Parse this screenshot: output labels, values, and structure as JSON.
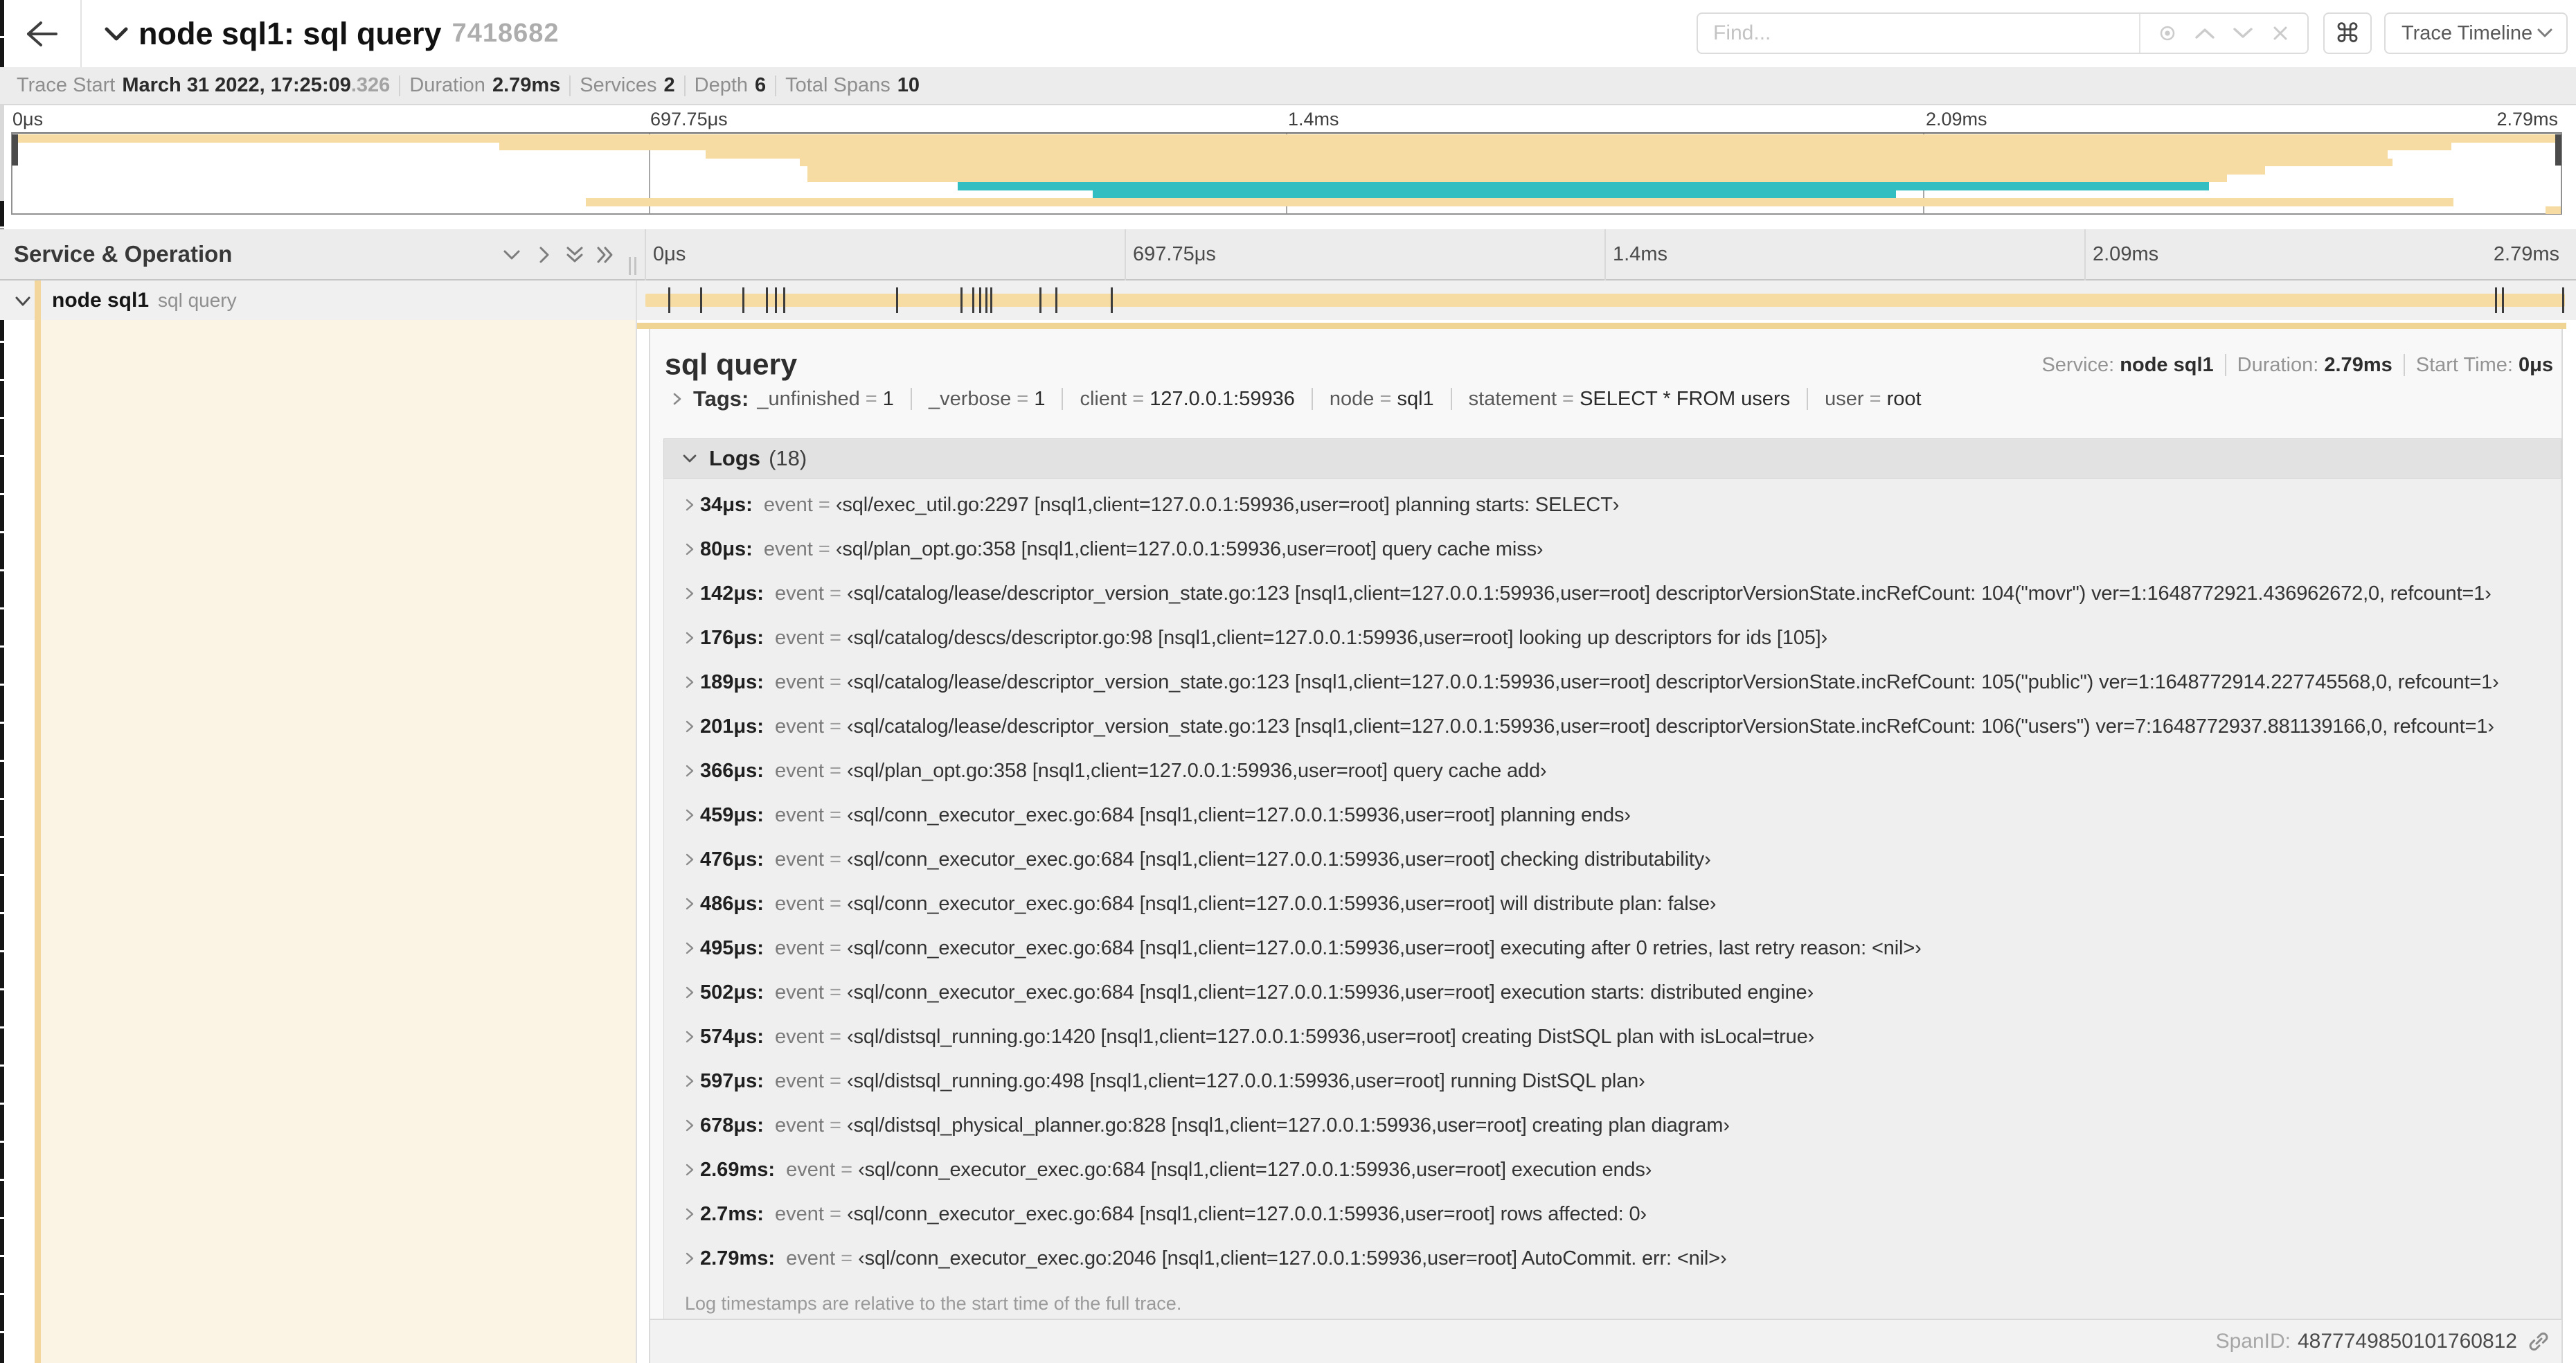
{
  "header": {
    "title": "node sql1: sql query",
    "trace_id": "7418682",
    "find_placeholder": "Find...",
    "view_dropdown_label": "Trace Timeline",
    "kbd_shortcut": "⌘"
  },
  "trace_stats": [
    {
      "label": "Trace Start",
      "value": "March 31 2022, 17:25:09",
      "suffix": ".326"
    },
    {
      "label": "Duration",
      "value": "2.79ms"
    },
    {
      "label": "Services",
      "value": "2"
    },
    {
      "label": "Depth",
      "value": "6"
    },
    {
      "label": "Total Spans",
      "value": "10"
    }
  ],
  "timeline": {
    "column_header": "Service & Operation",
    "ticks": [
      {
        "label": "0μs",
        "pct": 0
      },
      {
        "label": "697.75μs",
        "pct": 25
      },
      {
        "label": "1.4ms",
        "pct": 50
      },
      {
        "label": "2.09ms",
        "pct": 75
      },
      {
        "label": "2.79ms",
        "pct": 100,
        "align": "right"
      }
    ]
  },
  "chart_data": {
    "type": "gantt-minimap",
    "title": "trace span overview",
    "xlabel_ticks": [
      "0μs",
      "697.75μs",
      "1.4ms",
      "2.09ms",
      "2.79ms"
    ],
    "duration": "2.79ms",
    "spans": [
      {
        "start_pct": 0.0,
        "end_pct": 100.0,
        "color": "tan"
      },
      {
        "start_pct": 19.1,
        "end_pct": 95.7,
        "color": "tan"
      },
      {
        "start_pct": 27.2,
        "end_pct": 93.2,
        "color": "tan"
      },
      {
        "start_pct": 30.9,
        "end_pct": 93.4,
        "color": "tan"
      },
      {
        "start_pct": 31.2,
        "end_pct": 88.4,
        "color": "tan"
      },
      {
        "start_pct": 31.2,
        "end_pct": 86.9,
        "color": "tan"
      },
      {
        "start_pct": 37.1,
        "end_pct": 86.2,
        "color": "teal"
      },
      {
        "start_pct": 42.4,
        "end_pct": 73.9,
        "color": "teal"
      },
      {
        "start_pct": 22.5,
        "end_pct": 95.8,
        "color": "tan"
      },
      {
        "start_pct": 99.4,
        "end_pct": 100.0,
        "color": "tan"
      }
    ]
  },
  "span_row": {
    "service": "node sql1",
    "operation": "sql query",
    "bar_start_pct": 0,
    "bar_end_pct": 100
  },
  "detail": {
    "title": "sql query",
    "summary": [
      {
        "label": "Service: ",
        "value": "node sql1"
      },
      {
        "label": "Duration: ",
        "value": "2.79ms"
      },
      {
        "label": "Start Time: ",
        "value": "0μs"
      }
    ],
    "tags_label": "Tags:",
    "tags": [
      {
        "key": "_unfinished",
        "value": "1"
      },
      {
        "key": "_verbose",
        "value": "1"
      },
      {
        "key": "client",
        "value": "127.0.0.1:59936"
      },
      {
        "key": "node",
        "value": "sql1"
      },
      {
        "key": "statement",
        "value": "SELECT * FROM users"
      },
      {
        "key": "user",
        "value": "root"
      }
    ],
    "logs_label": "Logs",
    "logs_count": "(18)",
    "logs_key": "event",
    "logs": [
      {
        "time": "34μs:",
        "pct": 1.22,
        "value": "‹sql/exec_util.go:2297 [nsql1,client=127.0.0.1:59936,user=root] planning starts: SELECT›"
      },
      {
        "time": "80μs:",
        "pct": 2.87,
        "value": "‹sql/plan_opt.go:358 [nsql1,client=127.0.0.1:59936,user=root] query cache miss›"
      },
      {
        "time": "142μs:",
        "pct": 5.09,
        "value": "‹sql/catalog/lease/descriptor_version_state.go:123 [nsql1,client=127.0.0.1:59936,user=root] descriptorVersionState.incRefCount: 104(\"movr\") ver=1:1648772921.436962672,0, refcount=1›"
      },
      {
        "time": "176μs:",
        "pct": 6.31,
        "value": "‹sql/catalog/descs/descriptor.go:98 [nsql1,client=127.0.0.1:59936,user=root] looking up descriptors for ids [105]›"
      },
      {
        "time": "189μs:",
        "pct": 6.77,
        "value": "‹sql/catalog/lease/descriptor_version_state.go:123 [nsql1,client=127.0.0.1:59936,user=root] descriptorVersionState.incRefCount: 105(\"public\") ver=1:1648772914.227745568,0, refcount=1›"
      },
      {
        "time": "201μs:",
        "pct": 7.2,
        "value": "‹sql/catalog/lease/descriptor_version_state.go:123 [nsql1,client=127.0.0.1:59936,user=root] descriptorVersionState.incRefCount: 106(\"users\") ver=7:1648772937.881139166,0, refcount=1›"
      },
      {
        "time": "366μs:",
        "pct": 13.11,
        "value": "‹sql/plan_opt.go:358 [nsql1,client=127.0.0.1:59936,user=root] query cache add›"
      },
      {
        "time": "459μs:",
        "pct": 16.45,
        "value": "‹sql/conn_executor_exec.go:684 [nsql1,client=127.0.0.1:59936,user=root] planning ends›"
      },
      {
        "time": "476μs:",
        "pct": 17.06,
        "value": "‹sql/conn_executor_exec.go:684 [nsql1,client=127.0.0.1:59936,user=root] checking distributability›"
      },
      {
        "time": "486μs:",
        "pct": 17.41,
        "value": "‹sql/conn_executor_exec.go:684 [nsql1,client=127.0.0.1:59936,user=root] will distribute plan: false›"
      },
      {
        "time": "495μs:",
        "pct": 17.74,
        "value": "‹sql/conn_executor_exec.go:684 [nsql1,client=127.0.0.1:59936,user=root] executing after 0 retries, last retry reason: <nil>›"
      },
      {
        "time": "502μs:",
        "pct": 17.99,
        "value": "‹sql/conn_executor_exec.go:684 [nsql1,client=127.0.0.1:59936,user=root] execution starts: distributed engine›"
      },
      {
        "time": "574μs:",
        "pct": 20.57,
        "value": "‹sql/distsql_running.go:1420 [nsql1,client=127.0.0.1:59936,user=root] creating DistSQL plan with isLocal=true›"
      },
      {
        "time": "597μs:",
        "pct": 21.39,
        "value": "‹sql/distsql_running.go:498 [nsql1,client=127.0.0.1:59936,user=root] running DistSQL plan›"
      },
      {
        "time": "678μs:",
        "pct": 24.29,
        "value": "‹sql/distsql_physical_planner.go:828 [nsql1,client=127.0.0.1:59936,user=root] creating plan diagram›"
      },
      {
        "time": "2.69ms:",
        "pct": 96.38,
        "value": "‹sql/conn_executor_exec.go:684 [nsql1,client=127.0.0.1:59936,user=root] execution ends›"
      },
      {
        "time": "2.7ms:",
        "pct": 96.74,
        "value": "‹sql/conn_executor_exec.go:684 [nsql1,client=127.0.0.1:59936,user=root] rows affected: 0›"
      },
      {
        "time": "2.79ms:",
        "pct": 99.9,
        "value": "‹sql/conn_executor_exec.go:2046 [nsql1,client=127.0.0.1:59936,user=root] AutoCommit. err: <nil>›"
      }
    ],
    "logs_note": "Log timestamps are relative to the start time of the full trace.",
    "spanid_label": "SpanID:",
    "spanid_value": "4877749850101760812"
  },
  "colors": {
    "span_tan": "#f6dca2",
    "span_teal": "#33bfc2",
    "indent_strip": "#f3d69b",
    "subtree_cream": "#fbf4e4",
    "accent_line": "#f0d494"
  }
}
